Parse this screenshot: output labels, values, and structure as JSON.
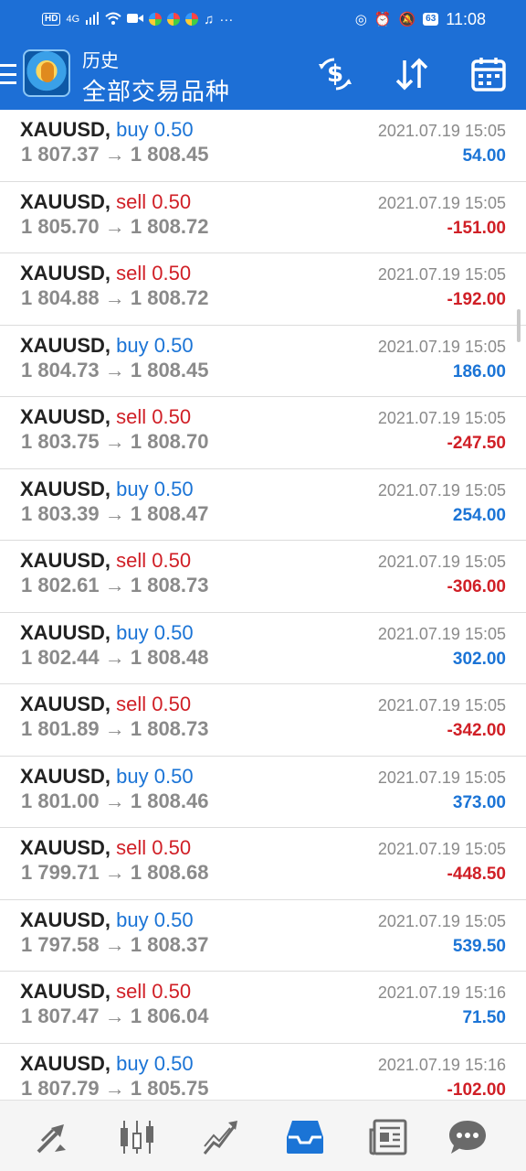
{
  "status_bar": {
    "indicators": [
      "HD",
      "4G",
      "signal-icon",
      "wifi-icon",
      "video-icon",
      "app-icon",
      "app-icon",
      "app-icon",
      "music-icon"
    ],
    "overflow": "···",
    "battery": "63",
    "time": "11:08"
  },
  "header": {
    "title": "历史",
    "subtitle": "全部交易品种"
  },
  "trades": [
    {
      "symbol": "XAUUSD,",
      "side": "buy",
      "volume": "0.50",
      "prices": "1 807.37 → 1 808.45",
      "date": "2021.07.19 15:05",
      "profit": "54.00"
    },
    {
      "symbol": "XAUUSD,",
      "side": "sell",
      "volume": "0.50",
      "prices": "1 805.70 → 1 808.72",
      "date": "2021.07.19 15:05",
      "profit": "-151.00"
    },
    {
      "symbol": "XAUUSD,",
      "side": "sell",
      "volume": "0.50",
      "prices": "1 804.88 → 1 808.72",
      "date": "2021.07.19 15:05",
      "profit": "-192.00"
    },
    {
      "symbol": "XAUUSD,",
      "side": "buy",
      "volume": "0.50",
      "prices": "1 804.73 → 1 808.45",
      "date": "2021.07.19 15:05",
      "profit": "186.00"
    },
    {
      "symbol": "XAUUSD,",
      "side": "sell",
      "volume": "0.50",
      "prices": "1 803.75 → 1 808.70",
      "date": "2021.07.19 15:05",
      "profit": "-247.50"
    },
    {
      "symbol": "XAUUSD,",
      "side": "buy",
      "volume": "0.50",
      "prices": "1 803.39 → 1 808.47",
      "date": "2021.07.19 15:05",
      "profit": "254.00"
    },
    {
      "symbol": "XAUUSD,",
      "side": "sell",
      "volume": "0.50",
      "prices": "1 802.61 → 1 808.73",
      "date": "2021.07.19 15:05",
      "profit": "-306.00"
    },
    {
      "symbol": "XAUUSD,",
      "side": "buy",
      "volume": "0.50",
      "prices": "1 802.44 → 1 808.48",
      "date": "2021.07.19 15:05",
      "profit": "302.00"
    },
    {
      "symbol": "XAUUSD,",
      "side": "sell",
      "volume": "0.50",
      "prices": "1 801.89 → 1 808.73",
      "date": "2021.07.19 15:05",
      "profit": "-342.00"
    },
    {
      "symbol": "XAUUSD,",
      "side": "buy",
      "volume": "0.50",
      "prices": "1 801.00 → 1 808.46",
      "date": "2021.07.19 15:05",
      "profit": "373.00"
    },
    {
      "symbol": "XAUUSD,",
      "side": "sell",
      "volume": "0.50",
      "prices": "1 799.71 → 1 808.68",
      "date": "2021.07.19 15:05",
      "profit": "-448.50"
    },
    {
      "symbol": "XAUUSD,",
      "side": "buy",
      "volume": "0.50",
      "prices": "1 797.58 → 1 808.37",
      "date": "2021.07.19 15:05",
      "profit": "539.50"
    },
    {
      "symbol": "XAUUSD,",
      "side": "sell",
      "volume": "0.50",
      "prices": "1 807.47 → 1 806.04",
      "date": "2021.07.19 15:16",
      "profit": "71.50"
    },
    {
      "symbol": "XAUUSD,",
      "side": "buy",
      "volume": "0.50",
      "prices": "1 807.79 → 1 805.75",
      "date": "2021.07.19 15:16",
      "profit": "-102.00"
    }
  ],
  "colors": {
    "primary": "#1d6fd6",
    "buy": "#1b74d6",
    "sell": "#d01f26",
    "muted": "#8a8a8a"
  },
  "bottom_nav": [
    {
      "name": "nav-quotes",
      "icon": "quotes-icon",
      "active": false
    },
    {
      "name": "nav-chart",
      "icon": "candlestick-icon",
      "active": false
    },
    {
      "name": "nav-trade",
      "icon": "trade-icon",
      "active": false
    },
    {
      "name": "nav-history",
      "icon": "inbox-icon",
      "active": true
    },
    {
      "name": "nav-news",
      "icon": "news-icon",
      "active": false
    },
    {
      "name": "nav-chat",
      "icon": "chat-icon",
      "active": false
    }
  ]
}
